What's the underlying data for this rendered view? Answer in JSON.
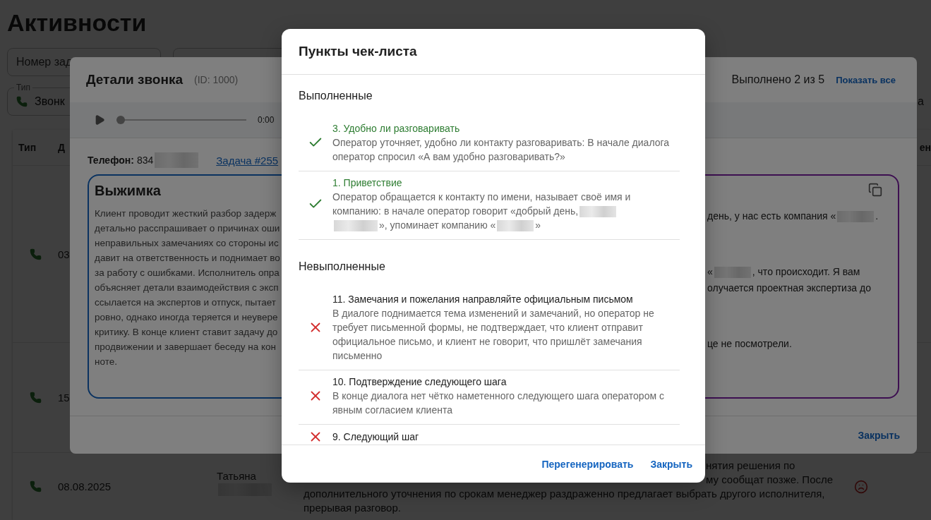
{
  "page": {
    "title": "Активности",
    "filters": {
      "task_number": {
        "placeholder": "Номер зад"
      },
      "type": {
        "label": "Тип",
        "value": "Звонк"
      }
    },
    "right_fragment": "а"
  },
  "table": {
    "columns": [
      "Тип",
      "Д",
      "ен"
    ],
    "rows": [
      {
        "kind": "call",
        "date": "03"
      },
      {
        "kind": "call",
        "date": "15"
      },
      {
        "kind": "call",
        "date": "08.08.2025",
        "manager": "Татьяна",
        "summary_lines": [
          "нятия решения по",
          "му сообщат позже. После",
          "дополнительного уточнения по срокам менеджер раздраженно предлагает выбрать другого исполнителя,",
          "прерывая разговор."
        ],
        "mood": {
          "kind": "sad"
        }
      }
    ]
  },
  "call_details": {
    "title": "Детали звонка",
    "id": "(ID: 1000)",
    "progress": "Выполнено 2 из 5",
    "show_all": "Показать все",
    "player": {
      "level": 0,
      "time": "0:00"
    },
    "phone_label": "Телефон:",
    "phone_value": "834",
    "task_link": "Задача #255",
    "summary": {
      "title": "Выжимка",
      "lines": [
        "Клиент проводит жесткий разбор задерж",
        "детально расспрашивает о причинах оши",
        "неправильных замечаниях со стороны ис",
        "давит на ответственность и поднимает во",
        "за работу с ошибками. Исполнитель опра",
        "объясняет детали взаимодействия с эксп",
        "ссылается на экспертов и отпуск, пытает",
        "ровно, однако иногда теряется и неувере",
        "критику. В конце клиент ставит задачу до",
        "продвижении и завершает беседу на кон",
        "ноте."
      ]
    },
    "transcript": [
      {
        "lines": [
          [
            {
              "kind": "text",
              "text": "день, у нас есть компания «"
            },
            {
              "kind": "redacted"
            },
            {
              "kind": "text",
              "text": "."
            }
          ]
        ]
      },
      {
        "lines": [
          [
            {
              "kind": "text",
              "text": "«"
            },
            {
              "kind": "redacted"
            },
            {
              "kind": "text",
              "text": ", что происходит.  Я вам"
            }
          ],
          [
            {
              "kind": "text",
              "text": "олучается проектная экспертиза до"
            }
          ]
        ]
      },
      {
        "lines": [
          [
            {
              "kind": "text",
              "text": "це не посмотрели."
            }
          ]
        ]
      }
    ],
    "close": "Закрыть"
  },
  "checklist_dialog": {
    "title": "Пункты чек-листа",
    "sections": [
      {
        "heading": "Выполненные",
        "items": [
          {
            "done": true,
            "title": "3. Удобно ли разговаривать",
            "description": [
              [
                {
                  "kind": "text",
                  "text": "Оператор уточняет, удобно ли контакту разговаривать: В начале диалога оператор спросил «А вам удобно разговаривать?»"
                }
              ]
            ]
          },
          {
            "done": true,
            "title": "1. Приветствие",
            "description": [
              [
                {
                  "kind": "text",
                  "text": "Оператор обращается к контакту по имени, называет своё имя и"
                }
              ],
              [
                {
                  "kind": "text",
                  "text": "компанию: в начале оператор говорит «добрый день,"
                },
                {
                  "kind": "redacted"
                }
              ],
              [
                {
                  "kind": "redacted"
                },
                {
                  "kind": "text",
                  "text": "», упоминает компанию «"
                },
                {
                  "kind": "redacted"
                },
                {
                  "kind": "text",
                  "text": "»"
                }
              ]
            ]
          }
        ]
      },
      {
        "heading": "Невыполненные",
        "items": [
          {
            "done": false,
            "title": "11. Замечания и пожелания направляйте официальным письмом",
            "description": [
              [
                {
                  "kind": "text",
                  "text": "В диалоге поднимается тема изменений и замечаний, но оператор не требует письменной формы, не подтверждает, что клиент отправит официальное письмо, и клиент не говорит, что пришлёт замечания письменно"
                }
              ]
            ]
          },
          {
            "done": false,
            "title": "10. Подтверждение следующего шага",
            "description": [
              [
                {
                  "kind": "text",
                  "text": "В конце диалога нет чётко наметенного следующего шага оператором с явным согласием клиента"
                }
              ]
            ]
          },
          {
            "done": false,
            "title": "9. Следующий шаг"
          }
        ]
      }
    ],
    "buttons": [
      "Перегенерировать",
      "Закрыть"
    ]
  }
}
